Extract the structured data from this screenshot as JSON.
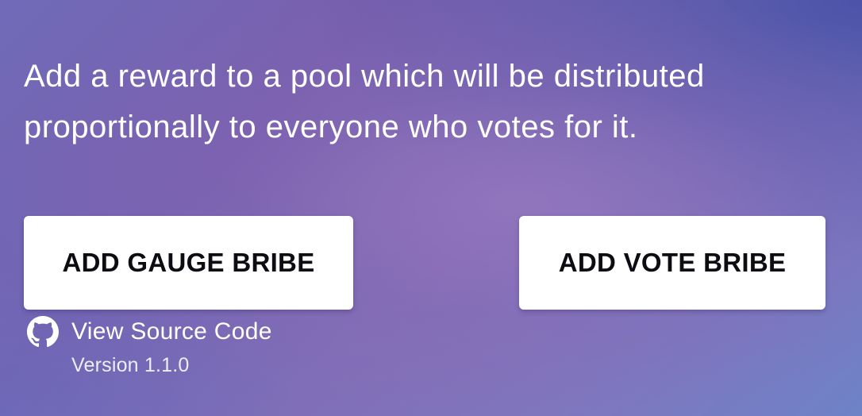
{
  "description": "Add a reward to a pool which will be distributed proportionally to everyone who votes for it.",
  "buttons": {
    "gauge_bribe": "ADD GAUGE BRIBE",
    "vote_bribe": "ADD VOTE BRIBE"
  },
  "footer": {
    "source_link_label": "View Source Code",
    "source_icon": "github-icon",
    "version": "Version 1.1.0"
  },
  "colors": {
    "button_background": "#ffffff",
    "button_text": "#0c0c12",
    "text": "#ffffff",
    "background_start": "#6f6bb8",
    "background_end": "#6e82c6"
  }
}
